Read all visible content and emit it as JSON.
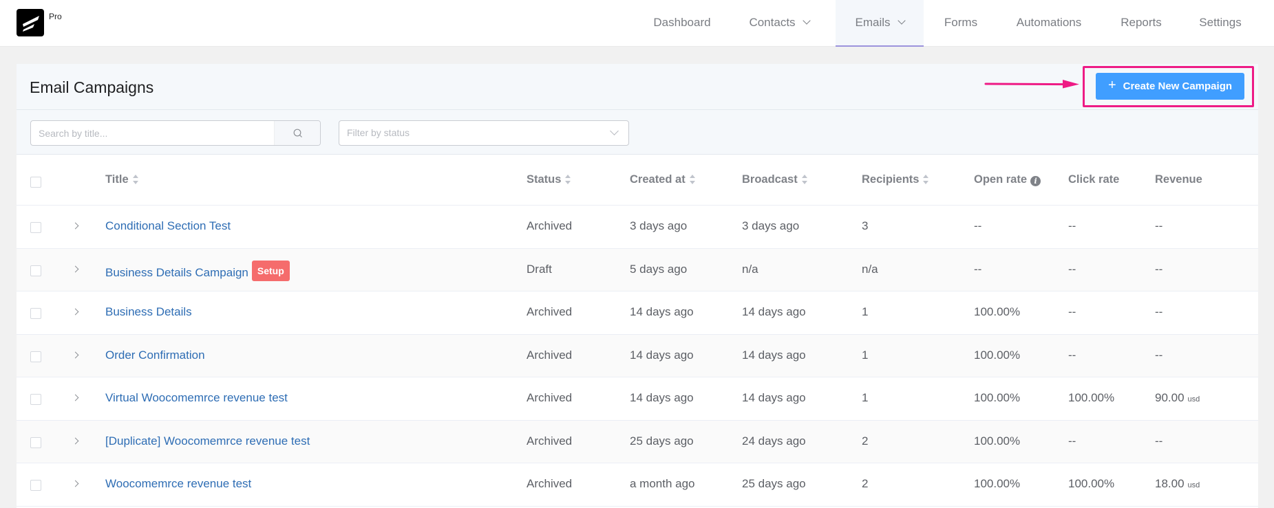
{
  "app": {
    "logo_icon": "fluentcrm-logo-icon",
    "pro_label": "Pro"
  },
  "nav": {
    "items": [
      {
        "label": "Dashboard",
        "has_dropdown": false,
        "active": false
      },
      {
        "label": "Contacts",
        "has_dropdown": true,
        "active": false
      },
      {
        "label": "Emails",
        "has_dropdown": true,
        "active": true
      },
      {
        "label": "Forms",
        "has_dropdown": false,
        "active": false
      },
      {
        "label": "Automations",
        "has_dropdown": false,
        "active": false
      },
      {
        "label": "Reports",
        "has_dropdown": false,
        "active": false
      },
      {
        "label": "Settings",
        "has_dropdown": false,
        "active": false
      }
    ]
  },
  "page": {
    "title": "Email Campaigns",
    "create_button_label": "Create New Campaign",
    "create_button_icon": "plus-icon",
    "annotation": {
      "type": "arrow-and-highlight",
      "color": "#ee1b85"
    }
  },
  "filters": {
    "search_placeholder": "Search by title...",
    "search_value": "",
    "search_icon": "search-icon",
    "status_placeholder": "Filter by status"
  },
  "table": {
    "columns": [
      {
        "key": "title",
        "label": "Title",
        "sortable": true
      },
      {
        "key": "status",
        "label": "Status",
        "sortable": true
      },
      {
        "key": "created_at",
        "label": "Created at",
        "sortable": true
      },
      {
        "key": "broadcast",
        "label": "Broadcast",
        "sortable": true
      },
      {
        "key": "recipients",
        "label": "Recipients",
        "sortable": true
      },
      {
        "key": "open_rate",
        "label": "Open rate",
        "sortable": false,
        "info_icon": true
      },
      {
        "key": "click_rate",
        "label": "Click rate",
        "sortable": false
      },
      {
        "key": "revenue",
        "label": "Revenue",
        "sortable": false
      }
    ],
    "rows": [
      {
        "title": "Conditional Section Test",
        "badge": "",
        "status": "Archived",
        "created_at": "3 days ago",
        "broadcast": "3 days ago",
        "recipients": "3",
        "open_rate": "--",
        "click_rate": "--",
        "revenue": "--",
        "revenue_unit": ""
      },
      {
        "title": "Business Details Campaign",
        "badge": "Setup",
        "status": "Draft",
        "created_at": "5 days ago",
        "broadcast": "n/a",
        "recipients": "n/a",
        "open_rate": "--",
        "click_rate": "--",
        "revenue": "--",
        "revenue_unit": ""
      },
      {
        "title": "Business Details",
        "badge": "",
        "status": "Archived",
        "created_at": "14 days ago",
        "broadcast": "14 days ago",
        "recipients": "1",
        "open_rate": "100.00%",
        "click_rate": "--",
        "revenue": "--",
        "revenue_unit": ""
      },
      {
        "title": "Order Confirmation",
        "badge": "",
        "status": "Archived",
        "created_at": "14 days ago",
        "broadcast": "14 days ago",
        "recipients": "1",
        "open_rate": "100.00%",
        "click_rate": "--",
        "revenue": "--",
        "revenue_unit": ""
      },
      {
        "title": "Virtual Woocomemrce revenue test",
        "badge": "",
        "status": "Archived",
        "created_at": "14 days ago",
        "broadcast": "14 days ago",
        "recipients": "1",
        "open_rate": "100.00%",
        "click_rate": "100.00%",
        "revenue": "90.00",
        "revenue_unit": "usd"
      },
      {
        "title": "[Duplicate] Woocomemrce revenue test",
        "badge": "",
        "status": "Archived",
        "created_at": "25 days ago",
        "broadcast": "24 days ago",
        "recipients": "2",
        "open_rate": "100.00%",
        "click_rate": "--",
        "revenue": "--",
        "revenue_unit": ""
      },
      {
        "title": "Woocomemrce revenue test",
        "badge": "",
        "status": "Archived",
        "created_at": "a month ago",
        "broadcast": "25 days ago",
        "recipients": "2",
        "open_rate": "100.00%",
        "click_rate": "100.00%",
        "revenue": "18.00",
        "revenue_unit": "usd"
      }
    ]
  },
  "colors": {
    "primary_button": "#409eff",
    "link": "#2e6db4",
    "setup_badge": "#f56c6c",
    "active_tab_underline": "#9b93dc",
    "annotation": "#ee1b85"
  }
}
